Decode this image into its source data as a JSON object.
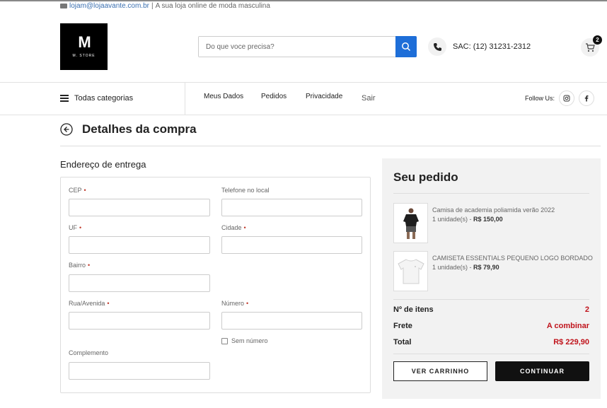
{
  "topbar": {
    "email": "lojam@lojaavante.com.br",
    "separator": "|",
    "tagline": "A sua loja online de moda masculina"
  },
  "logo": {
    "mark": "M",
    "text": "M. STORE"
  },
  "search": {
    "placeholder": "Do que voce precisa?"
  },
  "contact": {
    "sac": "SAC: (12) 31231-2312"
  },
  "cart": {
    "count": "2"
  },
  "nav": {
    "all_categories": "Todas categorias",
    "items": [
      "Meus Dados",
      "Pedidos",
      "Privacidade",
      "Sair"
    ],
    "follow": "Follow Us:"
  },
  "page": {
    "title": "Detalhes da compra"
  },
  "address": {
    "title": "Endereço de entrega",
    "labels": {
      "cep": "CEP",
      "telefone": "Telefone no local",
      "uf": "UF",
      "cidade": "Cidade",
      "bairro": "Bairro",
      "rua": "Rua/Avenida",
      "numero": "Número",
      "sem_numero": "Sem número",
      "complemento": "Complemento"
    },
    "required_mark": "•"
  },
  "order": {
    "title": "Seu pedido",
    "items": [
      {
        "name": "Camisa de academia poliamida verão 2022",
        "qty": "1 unidade(s) -",
        "price": "R$ 150,00"
      },
      {
        "name": "CAMISETA ESSENTIALS PEQUENO LOGO BORDADO",
        "qty": "1 unidade(s) -",
        "price": "R$ 79,90"
      }
    ],
    "summary": {
      "items_label": "Nº de itens",
      "items_value": "2",
      "frete_label": "Frete",
      "frete_value": "A combinar",
      "total_label": "Total",
      "total_value": "R$ 229,90"
    },
    "buttons": {
      "cart": "VER CARRINHO",
      "continue": "CONTINUAR"
    }
  },
  "colors": {
    "accent_blue": "#1e6ed8",
    "price_red": "#c0141c"
  }
}
